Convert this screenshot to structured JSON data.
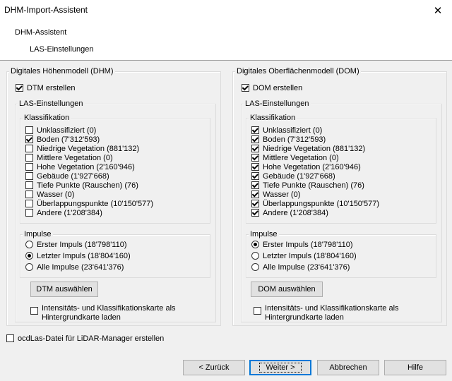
{
  "window": {
    "title": "DHM-Import-Assistent",
    "close_glyph": "✕"
  },
  "header": {
    "title": "DHM-Assistent",
    "subtitle": "LAS-Einstellungen"
  },
  "dtm": {
    "group_label": "Digitales Höhenmodell (DHM)",
    "create_label": "DTM erstellen",
    "create_checked": true,
    "las_label": "LAS-Einstellungen",
    "klass_label": "Klassifikation",
    "classes": [
      {
        "label": "Unklassifiziert  (0)",
        "checked": false
      },
      {
        "label": "Boden (7'312'593)",
        "checked": true
      },
      {
        "label": "Niedrige Vegetation (881'132)",
        "checked": false
      },
      {
        "label": "Mittlere Vegetation (0)",
        "checked": false
      },
      {
        "label": "Hohe Vegetation (2'160'946)",
        "checked": false
      },
      {
        "label": "Gebäude (1'927'668)",
        "checked": false
      },
      {
        "label": "Tiefe Punkte (Rauschen) (76)",
        "checked": false
      },
      {
        "label": "Wasser (0)",
        "checked": false
      },
      {
        "label": "Überlappungspunkte (10'150'577)",
        "checked": false
      },
      {
        "label": "Andere (1'208'384)",
        "checked": false
      }
    ],
    "impulse_label": "Impulse",
    "impulses": [
      {
        "label": "Erster Impuls (18'798'110)",
        "checked": false
      },
      {
        "label": "Letzter Impuls (18'804'160)",
        "checked": true
      },
      {
        "label": "Alle Impulse (23'641'376)",
        "checked": false
      }
    ],
    "select_button": "DTM auswählen",
    "bg_map_label": "Intensitäts- und Klassifikationskarte als Hintergrundkarte laden",
    "bg_map_checked": false
  },
  "dom": {
    "group_label": "Digitales Oberflächenmodell (DOM)",
    "create_label": "DOM erstellen",
    "create_checked": true,
    "las_label": "LAS-Einstellungen",
    "klass_label": "Klassifikation",
    "classes": [
      {
        "label": "Unklassifiziert  (0)",
        "checked": true
      },
      {
        "label": "Boden (7'312'593)",
        "checked": true
      },
      {
        "label": "Niedrige Vegetation (881'132)",
        "checked": true
      },
      {
        "label": "Mittlere Vegetation (0)",
        "checked": true
      },
      {
        "label": "Hohe Vegetation (2'160'946)",
        "checked": true
      },
      {
        "label": "Gebäude (1'927'668)",
        "checked": true
      },
      {
        "label": "Tiefe Punkte (Rauschen) (76)",
        "checked": true
      },
      {
        "label": "Wasser (0)",
        "checked": true
      },
      {
        "label": "Überlappungspunkte (10'150'577)",
        "checked": true
      },
      {
        "label": "Andere (1'208'384)",
        "checked": true
      }
    ],
    "impulse_label": "Impulse",
    "impulses": [
      {
        "label": "Erster Impuls (18'798'110)",
        "checked": true
      },
      {
        "label": "Letzter Impuls (18'804'160)",
        "checked": false
      },
      {
        "label": "Alle Impulse (23'641'376)",
        "checked": false
      }
    ],
    "select_button": "DOM auswählen",
    "bg_map_label": "Intensitäts- und Klassifikationskarte als Hintergrundkarte laden",
    "bg_map_checked": false
  },
  "ocdlas": {
    "label": "ocdLas-Datei für LiDAR-Manager erstellen",
    "checked": false
  },
  "footer": {
    "back": "< Zurück",
    "next": "Weiter >",
    "cancel": "Abbrechen",
    "help": "Hilfe"
  }
}
